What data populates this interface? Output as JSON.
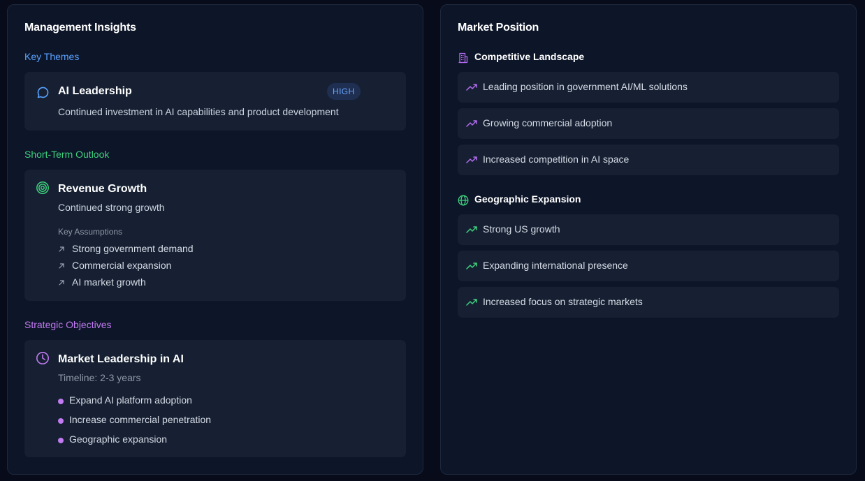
{
  "management": {
    "title": "Management Insights",
    "key_themes": {
      "label": "Key Themes",
      "items": [
        {
          "title": "AI Leadership",
          "badge": "HIGH",
          "description": "Continued investment in AI capabilities and product development",
          "icon": "chat-bubble-icon"
        }
      ]
    },
    "short_term": {
      "label": "Short-Term Outlook",
      "items": [
        {
          "title": "Revenue Growth",
          "description": "Continued strong growth",
          "assumptions_label": "Key Assumptions",
          "assumptions": [
            "Strong government demand",
            "Commercial expansion",
            "AI market growth"
          ],
          "icon": "target-icon"
        }
      ]
    },
    "strategic": {
      "label": "Strategic Objectives",
      "items": [
        {
          "title": "Market Leadership in AI",
          "timeline": "Timeline: 2-3 years",
          "bullets": [
            "Expand AI platform adoption",
            "Increase commercial penetration",
            "Geographic expansion"
          ],
          "icon": "clock-icon"
        }
      ]
    }
  },
  "market": {
    "title": "Market Position",
    "competitive": {
      "label": "Competitive Landscape",
      "icon": "building-icon",
      "items": [
        "Leading position in government AI/ML solutions",
        "Growing commercial adoption",
        "Increased competition in AI space"
      ]
    },
    "geographic": {
      "label": "Geographic Expansion",
      "icon": "globe-icon",
      "items": [
        "Strong US growth",
        "Expanding international presence",
        "Increased focus on strategic markets"
      ]
    }
  },
  "colors": {
    "key_themes": "#5aa2ff",
    "short_term": "#3ed07e",
    "strategic": "#c07bf0",
    "trend_purple": "#b26bf0",
    "trend_green": "#3ed07e",
    "badge_bg": "#1e2f52",
    "card_bg": "#162032",
    "panel_bg": "#0d1528"
  }
}
